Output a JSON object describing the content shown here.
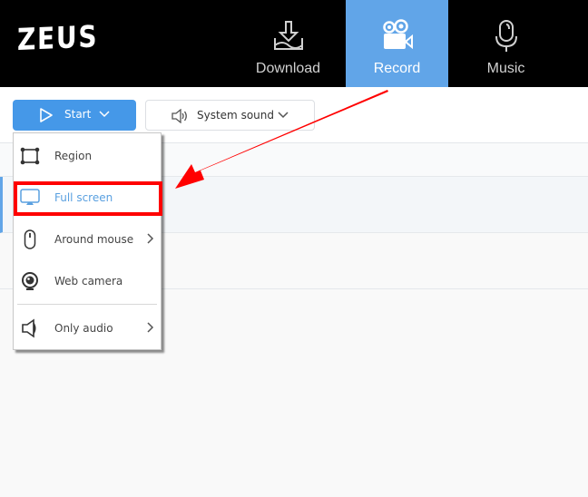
{
  "app": {
    "logo": "ZEUS"
  },
  "nav": {
    "tabs": [
      {
        "label": "Download",
        "icon": "download-icon",
        "active": false
      },
      {
        "label": "Record",
        "icon": "video-camera-icon",
        "active": true
      },
      {
        "label": "Music",
        "icon": "microphone-icon",
        "active": false
      }
    ]
  },
  "toolbar": {
    "start_label": "Start",
    "sound_label": "System sound"
  },
  "menu": {
    "items": [
      {
        "label": "Region",
        "icon": "region-icon",
        "submenu": false
      },
      {
        "label": "Full screen",
        "icon": "monitor-icon",
        "submenu": false,
        "highlighted": true
      },
      {
        "label": "Around mouse",
        "icon": "mouse-icon",
        "submenu": true
      },
      {
        "label": "Web camera",
        "icon": "webcam-icon",
        "submenu": false
      },
      {
        "label": "Only audio",
        "icon": "speaker-icon",
        "submenu": true
      }
    ]
  },
  "colors": {
    "accent": "#61a5e8",
    "button": "#4598e8",
    "annotation": "#ff0000"
  }
}
